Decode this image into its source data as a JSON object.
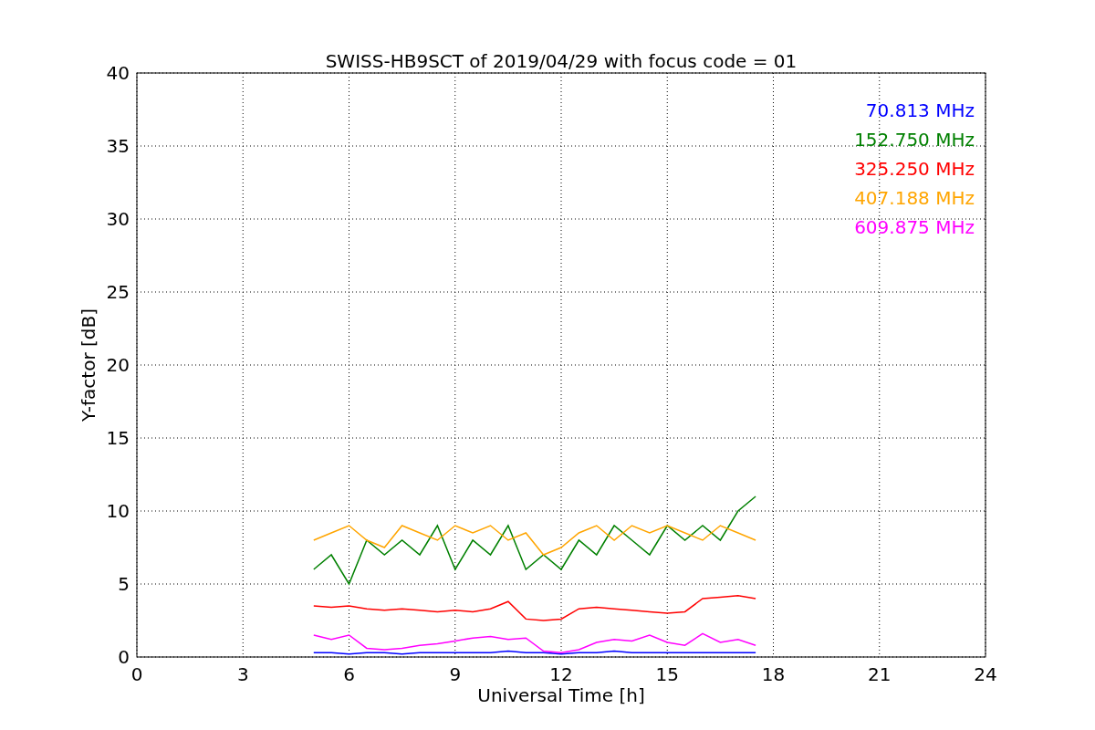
{
  "chart_data": {
    "type": "line",
    "title": "SWISS-HB9SCT of 2019/04/29 with focus code = 01",
    "xlabel": "Universal Time [h]",
    "ylabel": "Y-factor [dB]",
    "x": [
      5,
      5.5,
      6,
      6.5,
      7,
      7.5,
      8,
      8.5,
      9,
      9.5,
      10,
      10.5,
      11,
      11.5,
      12,
      12.5,
      13,
      13.5,
      14,
      14.5,
      15,
      15.5,
      16,
      16.5,
      17,
      17.5
    ],
    "xlim": [
      0,
      24
    ],
    "ylim": [
      0,
      40
    ],
    "xticks": [
      0,
      3,
      6,
      9,
      12,
      15,
      18,
      21,
      24
    ],
    "yticks": [
      0,
      5,
      10,
      15,
      20,
      25,
      30,
      35,
      40
    ],
    "grid": true,
    "series": [
      {
        "name": "70.813 MHz",
        "color": "#0000ff",
        "values": [
          0.3,
          0.3,
          0.2,
          0.3,
          0.3,
          0.2,
          0.3,
          0.3,
          0.3,
          0.3,
          0.3,
          0.4,
          0.3,
          0.3,
          0.2,
          0.3,
          0.3,
          0.4,
          0.3,
          0.3,
          0.3,
          0.3,
          0.3,
          0.3,
          0.3,
          0.3
        ]
      },
      {
        "name": "152.750 MHz",
        "color": "#008000",
        "values": [
          6,
          7,
          5,
          8,
          7,
          8,
          7,
          9,
          6,
          8,
          7,
          9,
          6,
          7,
          6,
          8,
          7,
          9,
          8,
          7,
          9,
          8,
          9,
          8,
          10,
          11
        ]
      },
      {
        "name": "325.250 MHz",
        "color": "#ff0000",
        "values": [
          3.5,
          3.4,
          3.5,
          3.3,
          3.2,
          3.3,
          3.2,
          3.1,
          3.2,
          3.1,
          3.3,
          3.8,
          2.6,
          2.5,
          2.6,
          3.3,
          3.4,
          3.3,
          3.2,
          3.1,
          3.0,
          3.1,
          4.0,
          4.1,
          4.2,
          4.0
        ]
      },
      {
        "name": "407.188 MHz",
        "color": "#ffa500",
        "values": [
          8,
          8.5,
          9,
          8,
          7.5,
          9,
          8.5,
          8,
          9,
          8.5,
          9,
          8,
          8.5,
          7,
          7.5,
          8.5,
          9,
          8,
          9,
          8.5,
          9,
          8.5,
          8,
          9,
          8.5,
          8
        ]
      },
      {
        "name": "609.875 MHz",
        "color": "#ff00ff",
        "values": [
          1.5,
          1.2,
          1.5,
          0.6,
          0.5,
          0.6,
          0.8,
          0.9,
          1.1,
          1.3,
          1.4,
          1.2,
          1.3,
          0.4,
          0.3,
          0.5,
          1.0,
          1.2,
          1.1,
          1.5,
          1.0,
          0.8,
          1.6,
          1.0,
          1.2,
          0.8
        ]
      }
    ]
  }
}
